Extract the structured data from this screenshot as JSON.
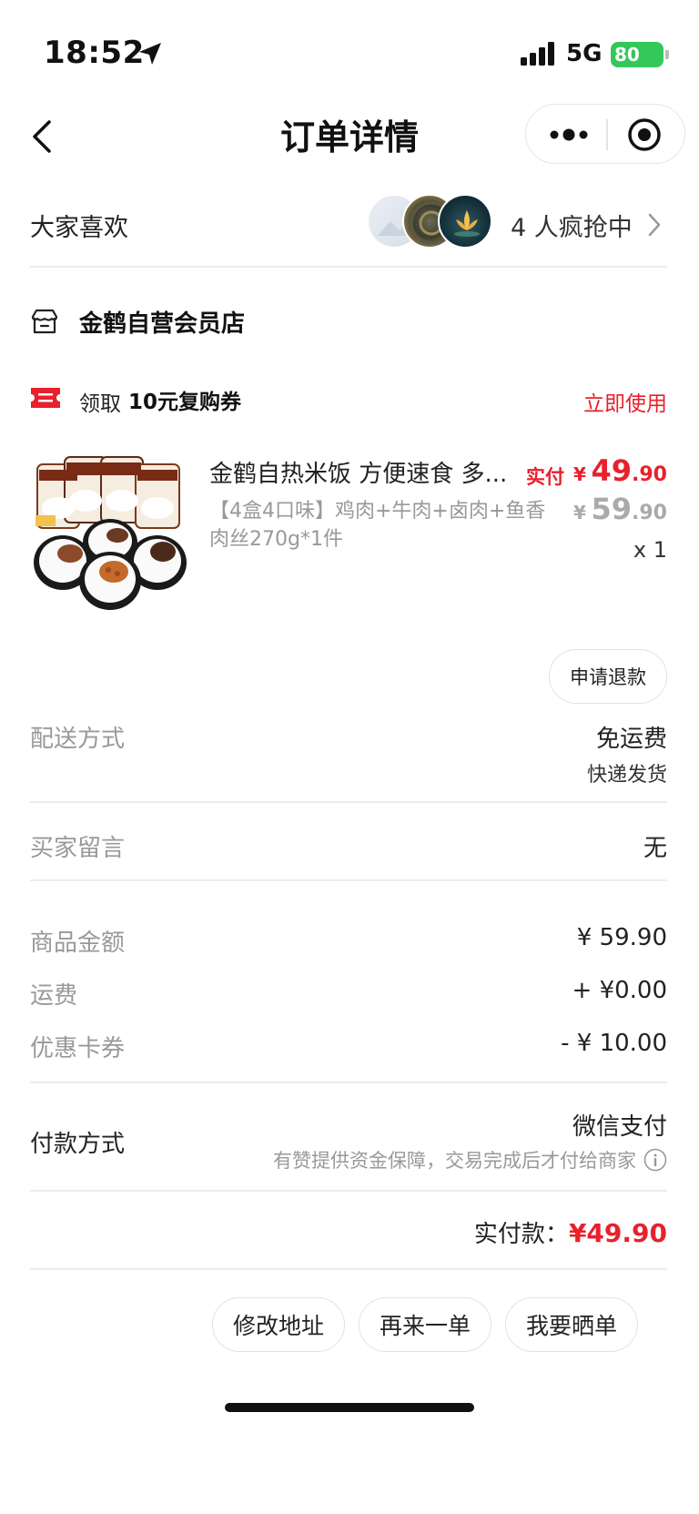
{
  "status_bar": {
    "time": "18:52",
    "network": "5G",
    "battery": "80"
  },
  "nav": {
    "title": "订单详情"
  },
  "likes": {
    "label": "大家喜欢",
    "count_text": "4 人疯抢中"
  },
  "store": {
    "name": "金鹤自营会员店"
  },
  "coupon": {
    "prefix": "领取",
    "amount": "10元复购券",
    "action": "立即使用"
  },
  "product": {
    "title": "金鹤自热米饭 方便速食 多...",
    "sku": "【4盒4口味】鸡肉+牛肉+卤肉+鱼香肉丝270g*1件",
    "paid_label": "实付",
    "currency": "¥",
    "paid_int": "49",
    "paid_dec": ".90",
    "orig_int": "59",
    "orig_dec": ".90",
    "quantity": "x 1"
  },
  "refund_button": "申请退款",
  "delivery": {
    "label": "配送方式",
    "value": "免运费",
    "sub": "快递发货"
  },
  "buyer_message": {
    "label": "买家留言",
    "value": "无"
  },
  "amounts": {
    "goods_label": "商品金额",
    "goods_value": "¥ 59.90",
    "shipping_label": "运费",
    "shipping_value": "+ ¥0.00",
    "discount_label": "优惠卡券",
    "discount_value": "- ¥ 10.00"
  },
  "payment": {
    "label": "付款方式",
    "value": "微信支付",
    "note": "有赞提供资金保障，交易完成后才付给商家"
  },
  "total": {
    "label": "实付款：",
    "value": "¥49.90"
  },
  "actions": {
    "modify_address": "修改地址",
    "reorder": "再来一单",
    "share": "我要晒单"
  },
  "colors": {
    "accent_red": "#e8212c",
    "battery_green": "#34c759"
  }
}
